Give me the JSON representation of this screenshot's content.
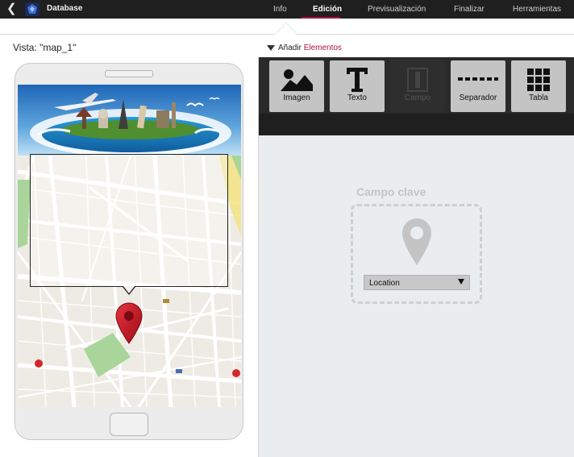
{
  "app": {
    "title": "Database"
  },
  "nav": {
    "tabs": [
      {
        "label": "Info",
        "active": false
      },
      {
        "label": "Edición",
        "active": true
      },
      {
        "label": "Previsualización",
        "active": false
      },
      {
        "label": "Finalizar",
        "active": false
      },
      {
        "label": "Herramientas",
        "active": false
      }
    ],
    "accent_color": "#b01042"
  },
  "subheader": {
    "vista_label": "Vista: \"map_1\"",
    "add_prefix": "Añadir",
    "add_accent": "Elementos"
  },
  "toolbar": {
    "tools": [
      {
        "label": "Imagen",
        "icon": "image-icon",
        "enabled": true
      },
      {
        "label": "Texto",
        "icon": "text-icon",
        "enabled": true
      },
      {
        "label": "Campo",
        "icon": "field-icon",
        "enabled": false
      },
      {
        "label": "Separador",
        "icon": "separator-icon",
        "enabled": true
      },
      {
        "label": "Tabla",
        "icon": "table-icon",
        "enabled": true
      }
    ]
  },
  "keyfield": {
    "title": "Campo clave",
    "selected": "Location",
    "icon": "map-pin-icon"
  },
  "phone": {
    "banner_icon": "travel-landmarks-image",
    "map_icon": "street-map",
    "pin_color": "#c8101c"
  }
}
